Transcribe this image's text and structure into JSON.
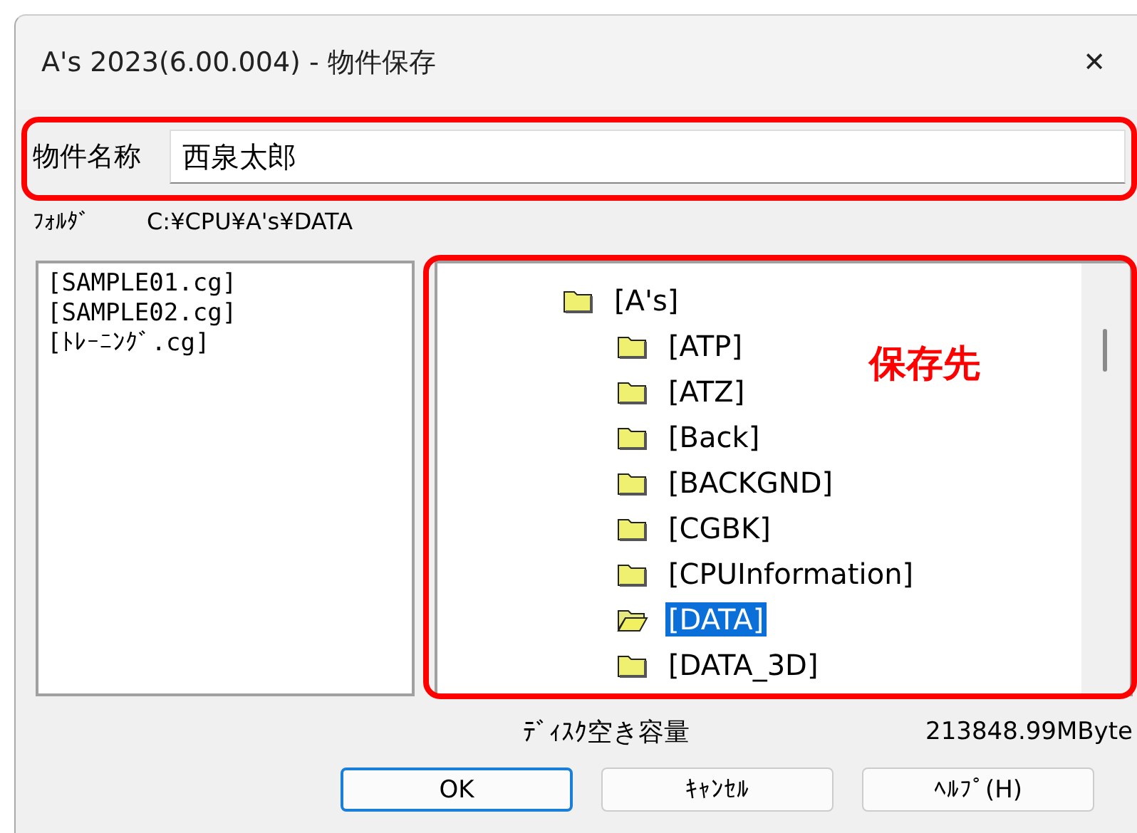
{
  "window": {
    "title": "A's 2023(6.00.004) - 物件保存",
    "close": "✕"
  },
  "name_field": {
    "label": "物件名称",
    "value": "西泉太郎"
  },
  "folder": {
    "label": "ﾌｫﾙﾀﾞ",
    "path": "C:¥CPU¥A's¥DATA"
  },
  "files": [
    "[SAMPLE01.cg]",
    "[SAMPLE02.cg]",
    "[ﾄﾚｰﾆﾝｸﾞ.cg]"
  ],
  "tree": [
    {
      "label": "[A's]",
      "selected": false,
      "children": [
        {
          "label": "[ATP]",
          "selected": false
        },
        {
          "label": "[ATZ]",
          "selected": false
        },
        {
          "label": "[Back]",
          "selected": false
        },
        {
          "label": "[BACKGND]",
          "selected": false
        },
        {
          "label": "[CGBK]",
          "selected": false
        },
        {
          "label": "[CPUInformation]",
          "selected": false
        },
        {
          "label": "[DATA]",
          "selected": true
        },
        {
          "label": "[DATA_3D]",
          "selected": false
        }
      ]
    }
  ],
  "annotation": {
    "label": "保存先"
  },
  "disk": {
    "label": "ﾃﾞｨｽｸ空き容量",
    "value": "213848.99MByte"
  },
  "buttons": [
    {
      "label": "OK",
      "default": true
    },
    {
      "label": "ｷｬﾝｾﾙ",
      "default": false
    },
    {
      "label": "ﾍﾙﾌﾟ(H)",
      "default": false
    }
  ]
}
